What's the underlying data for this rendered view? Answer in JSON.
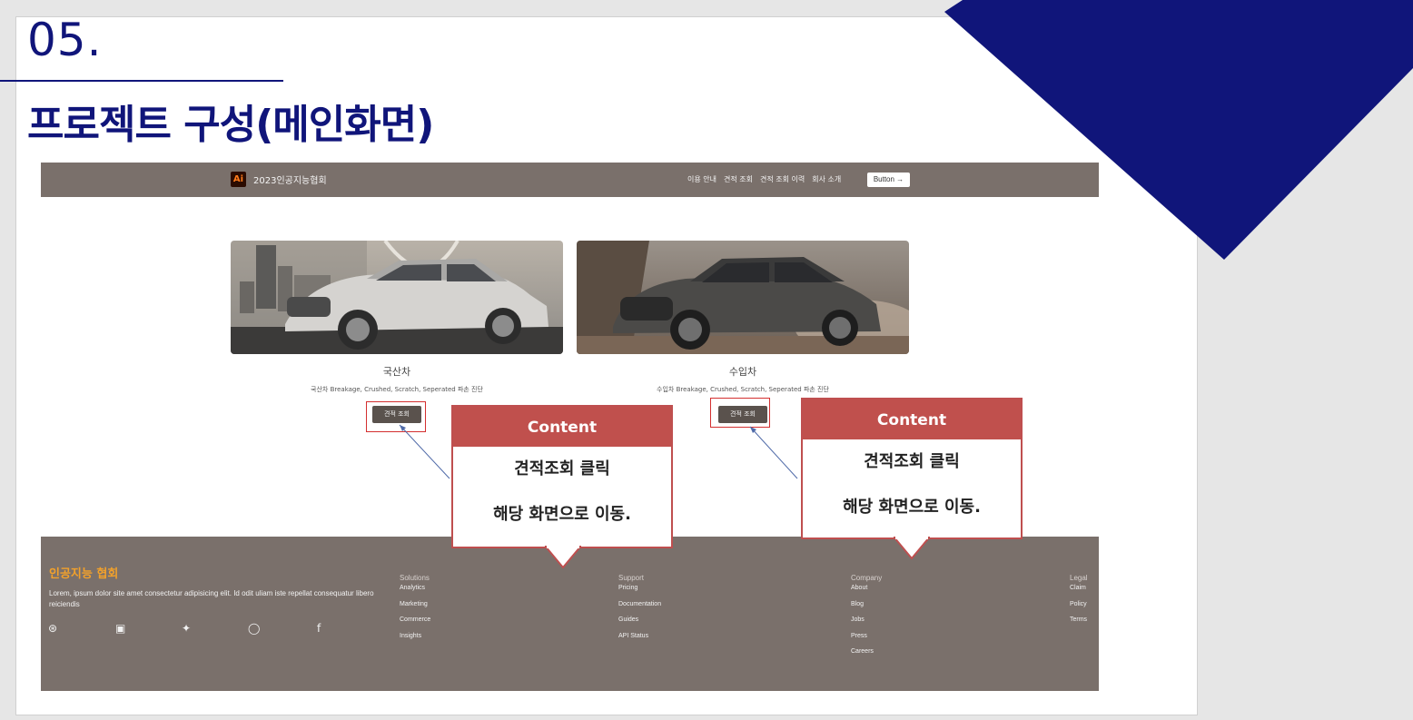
{
  "slide": {
    "section_number": "05.",
    "title": "프로젝트 구성(메인화면)",
    "accent_color": "#10157a"
  },
  "site": {
    "brand_logo": "Ai",
    "brand_name": "2023인공지능협회",
    "nav": [
      "이용 안내",
      "견적 조회",
      "견적 조회 이력",
      "회사 소개"
    ],
    "nav_button": "Button →",
    "cards": [
      {
        "image": "silver-suv-photo",
        "title": "국산차",
        "desc": "국산차 Breakage, Crushed, Scratch, Seperated 파손 진단",
        "button": "견적 조회"
      },
      {
        "image": "dark-suv-photo",
        "title": "수입차",
        "desc": "수입차 Breakage, Crushed, Scratch, Seperated 파손 진단",
        "button": "견적 조회"
      }
    ],
    "footer": {
      "title": "인공지능 협회",
      "text": "Lorem, ipsum dolor site amet consectetur adipisicing elit. Id odit uliam iste repellat consequatur libero reiciendis",
      "social_icons": [
        "dribbble-icon",
        "youtube-icon",
        "twitter-icon",
        "github-icon",
        "facebook-icon"
      ],
      "columns": [
        {
          "heading": "Solutions",
          "links": [
            "Analytics",
            "Marketing",
            "Commerce",
            "Insights"
          ]
        },
        {
          "heading": "Support",
          "links": [
            "Pricing",
            "Documentation",
            "Guides",
            "API Status"
          ]
        },
        {
          "heading": "Company",
          "links": [
            "About",
            "Blog",
            "Jobs",
            "Press",
            "Careers"
          ]
        },
        {
          "heading": "Legal",
          "links": [
            "Claim",
            "Policy",
            "Terms"
          ]
        }
      ]
    }
  },
  "callouts": [
    {
      "heading": "Content",
      "line1": "견적조회 클릭",
      "line2": "해당 화면으로 이동."
    },
    {
      "heading": "Content",
      "line1": "견적조회 클릭",
      "line2": "해당 화면으로 이동."
    }
  ],
  "colors": {
    "nav_bg": "#7a706b",
    "callout_red": "#c0504d",
    "footer_title": "#f2a12b"
  }
}
